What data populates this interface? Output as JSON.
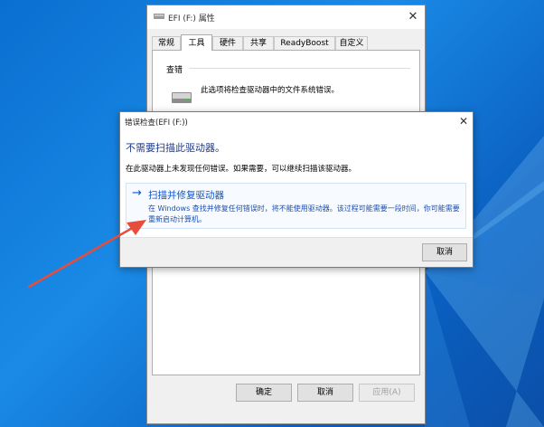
{
  "properties_window": {
    "title": "EFI (F:) 属性",
    "close_glyph": "✕",
    "tabs": [
      "常规",
      "工具",
      "硬件",
      "共享",
      "ReadyBoost",
      "自定义"
    ],
    "active_tab": "工具",
    "group_label": "查错",
    "group_description": "此选项将检查驱动器中的文件系统错误。",
    "buttons": {
      "ok": "确定",
      "cancel": "取消",
      "apply": "应用(A)"
    }
  },
  "error_check_dialog": {
    "title": "错误检查(EFI (F:))",
    "close_glyph": "✕",
    "heading": "不需要扫描此驱动器。",
    "subtext": "在此驱动器上未发现任何错误。如果需要，可以继续扫描该驱动器。",
    "command_link": {
      "arrow": "→",
      "title": "扫描并修复驱动器",
      "description": "在 Windows 查找并修复任何错误时，将不能使用驱动器。该过程可能需要一段时间，你可能需要重新启动计算机。"
    },
    "cancel_label": "取消"
  },
  "colors": {
    "desktop": "#1a8ae6",
    "accent_link": "#0b57d0",
    "heading": "#1e3a8a",
    "annotation_arrow": "#e74c3c"
  }
}
